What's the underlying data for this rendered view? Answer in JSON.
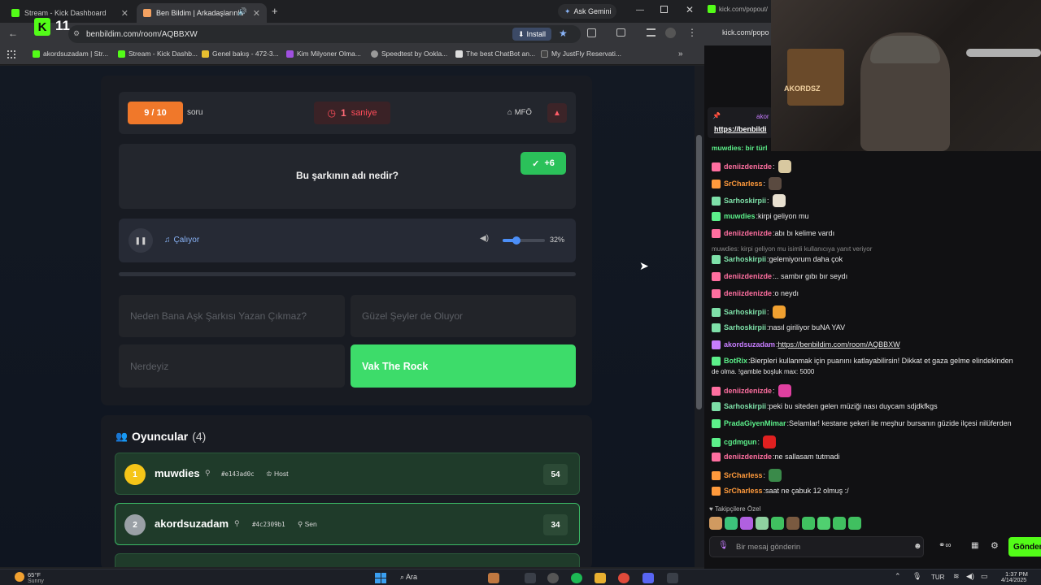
{
  "browser": {
    "tabs": [
      {
        "label": "Stream - Kick Dashboard",
        "active": false
      },
      {
        "label": "Ben Bildim | Arkadaşlarınla",
        "active": true
      }
    ],
    "ask_gemini": "Ask Gemini",
    "url": "benbildim.com/room/AQBBXW",
    "install_label": "Install",
    "overlay_counter": "11",
    "bookmarks": [
      "akordsuzadam | Str...",
      "Stream - Kick Dashb...",
      "Genel bakış - 472-3...",
      "Kim Milyoner Olma...",
      "Speedtest by Ookla...",
      "The best ChatBot an...",
      "My JustFly Reservati..."
    ]
  },
  "game": {
    "question_counter": "9 / 10",
    "question_label": "soru",
    "timer_value": "1",
    "timer_unit": "saniye",
    "category": "MFÖ",
    "question_text": "Bu şarkının adı nedir?",
    "points_badge": "+6",
    "playing_label": "Çalıyor",
    "volume_percent": "32%",
    "volume_level": 0.32,
    "options": [
      {
        "text": "Neden Bana Aşk Şarkısı Yazan Çıkmaz?",
        "correct": false
      },
      {
        "text": "Güzel Şeyler de Oluyor",
        "correct": false
      },
      {
        "text": "Nerdeyiz",
        "correct": false
      },
      {
        "text": "Vak The Rock",
        "correct": true
      }
    ]
  },
  "players": {
    "title": "Oyuncular",
    "count": "(4)",
    "list": [
      {
        "rank": "1",
        "name": "muwdies",
        "tag": "#e143ad0c",
        "role": "Host",
        "score": "54",
        "rank_color": "#f5c518"
      },
      {
        "rank": "2",
        "name": "akordsuzadam",
        "tag": "#4c2309b1",
        "role": "Sen",
        "score": "34",
        "rank_color": "#9aa0a6"
      }
    ]
  },
  "chat": {
    "popout_url": "kick.com/popout/",
    "pinned_user": "akor",
    "pinned_link": "https://benbildi",
    "top_line": "muwdies: bir türl",
    "messages": [
      {
        "user": "deniizdenizde",
        "text": "",
        "color": "#ff6fa0",
        "emote": "#d8c8a0"
      },
      {
        "user": "SrCharless",
        "text": "",
        "color": "#ff9a3c",
        "emote": "#5a4a40"
      },
      {
        "user": "Sarhoskirpii",
        "text": "",
        "color": "#7ee0a8",
        "emote": "#e8e0d0"
      },
      {
        "user": "muwdies",
        "text": "kirpi geliyon mu",
        "color": "#5cf08a",
        "emote": ""
      },
      {
        "user": "deniizdenizde",
        "text": "abı bı kelime vardı",
        "color": "#ff6fa0",
        "emote": ""
      },
      {
        "user": "",
        "text": "muwdies: kirpi geliyon mu isimli kullanıcıya yanıt veriyor",
        "color": "#8a8a8a",
        "emote": ""
      },
      {
        "user": "Sarhoskirpii",
        "text": "gelemiyorum daha çok",
        "color": "#7ee0a8",
        "emote": ""
      },
      {
        "user": "deniizdenizde",
        "text": ".. sambır gıbı bır seydı",
        "color": "#ff6fa0",
        "emote": ""
      },
      {
        "user": "deniizdenizde",
        "text": "o neydı",
        "color": "#ff6fa0",
        "emote": ""
      },
      {
        "user": "Sarhoskirpii",
        "text": "",
        "color": "#7ee0a8",
        "emote": "#f0a030"
      },
      {
        "user": "Sarhoskirpii",
        "text": "nasıl giriliyor buNA YAV",
        "color": "#7ee0a8",
        "emote": ""
      },
      {
        "user": "akordsuzadam",
        "text": "https://benbildim.com/room/AQBBXW",
        "color": "#c77dff",
        "emote": ""
      },
      {
        "user": "BotRix",
        "text": "Bierpleri kullanmak için puanını katlayabilirsin! Dikkat et gaza gelme elindekinden",
        "color": "#5cf08a",
        "emote": ""
      },
      {
        "user": "",
        "text": "de olma. !gamble boşluk max: 5000",
        "color": "#e8e8e8",
        "emote": ""
      },
      {
        "user": "deniizdenizde",
        "text": "",
        "color": "#ff6fa0",
        "emote": "#e040a0"
      },
      {
        "user": "Sarhoskirpii",
        "text": "peki bu siteden gelen müziği nası duycam sdjdkfkgs",
        "color": "#7ee0a8",
        "emote": ""
      },
      {
        "user": "PradaGiyenMimar",
        "text": "Selamlar! kestane şekeri ile meşhur bursanın güzide ilçesi nilüferden",
        "color": "#5cf08a",
        "emote": ""
      },
      {
        "user": "cgdmgun",
        "text": "",
        "color": "#5cf08a",
        "emote": "#e02020"
      },
      {
        "user": "deniizdenizde",
        "text": "ne sallasam tutmadi",
        "color": "#ff6fa0",
        "emote": ""
      },
      {
        "user": "SrCharless",
        "text": "",
        "color": "#ff9a3c",
        "emote": "#3a8a4a"
      },
      {
        "user": "SrCharless",
        "text": "saat ne çabuk 12 olmuş :/",
        "color": "#ff9a3c",
        "emote": ""
      }
    ],
    "followers_label": "Takipçilere Özel",
    "input_placeholder": "Bir mesaj gönderin",
    "send_label": "Gönder",
    "webcam_text": "AKORDSZ"
  },
  "taskbar": {
    "weather_temp": "65°F",
    "weather_desc": "Sunny",
    "search_label": "Ara",
    "lang": "TUR",
    "time": "1:37 PM",
    "date": "4/14/2025"
  }
}
